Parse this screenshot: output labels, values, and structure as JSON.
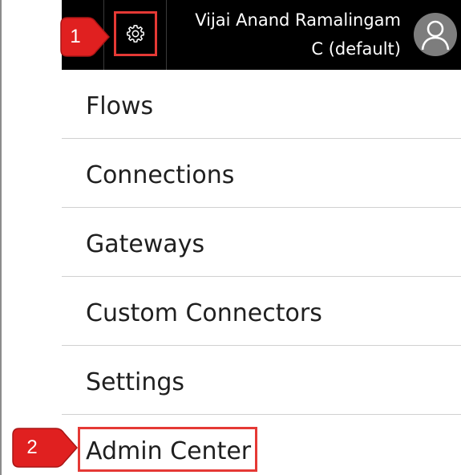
{
  "header": {
    "settings_icon": "gear-icon",
    "user_name": "Vijai Anand Ramalingam",
    "tenant": "C (default)",
    "avatar_icon": "person-icon"
  },
  "menu": {
    "items": [
      {
        "label": "Flows"
      },
      {
        "label": "Connections"
      },
      {
        "label": "Gateways"
      },
      {
        "label": "Custom Connectors"
      },
      {
        "label": "Settings"
      },
      {
        "label": "Admin Center"
      }
    ]
  },
  "callouts": [
    {
      "number": "1",
      "target": "settings"
    },
    {
      "number": "2",
      "target": "Admin Center"
    }
  ],
  "colors": {
    "topbar": "#000000",
    "highlight": "#e53935",
    "callout": "#e02020",
    "divider": "#d0d0d0",
    "avatar": "#7d7d7d"
  }
}
